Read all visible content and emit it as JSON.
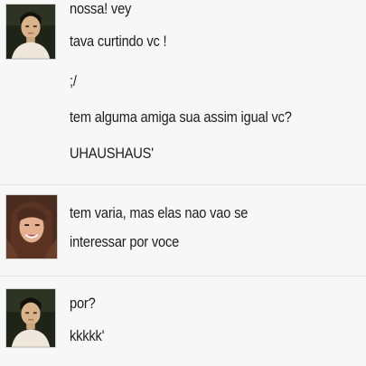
{
  "conversation": {
    "groups": [
      {
        "sender": "boy",
        "messages": [
          "nossa! vey",
          "tava curtindo vc !",
          ";/",
          "tem alguma amiga sua assim igual vc?",
          "UHAUSHAUS'"
        ]
      },
      {
        "sender": "girl",
        "messages": [
          "tem varia, mas elas nao vao se",
          "interessar por voce"
        ]
      },
      {
        "sender": "boy",
        "messages": [
          "por?",
          "kkkkk'"
        ]
      }
    ]
  },
  "colors": {
    "background": "#f7f7f7",
    "text": "#1d1d1d",
    "divider": "#e2e2e2"
  },
  "icons": [
    "boy-avatar-icon",
    "girl-avatar-icon"
  ]
}
